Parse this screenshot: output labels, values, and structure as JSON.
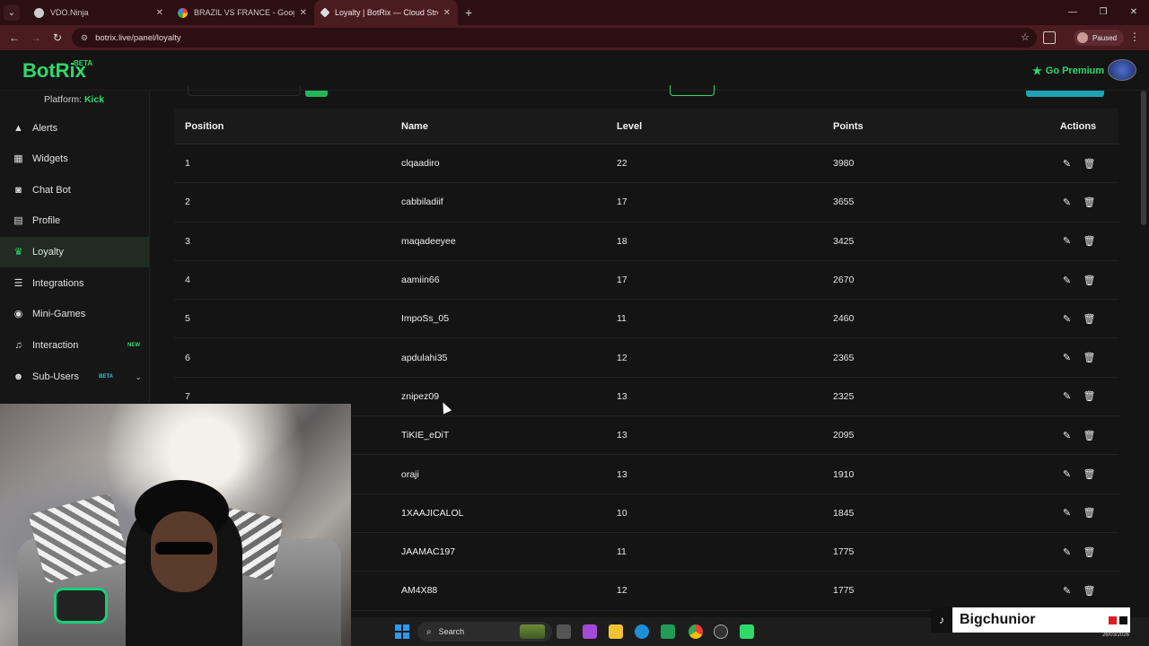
{
  "browser": {
    "tabs": [
      {
        "title": "VDO.Ninja",
        "active": false
      },
      {
        "title": "BRAZIL VS FRANCE - Google Se",
        "active": false
      },
      {
        "title": "Loyalty | BotRix — Cloud Stream",
        "active": true
      }
    ],
    "url": "botrix.live/panel/loyalty",
    "profile_status": "Paused"
  },
  "app": {
    "logo": "BotRix",
    "logo_badge": "BETA",
    "go_premium": "Go Premium",
    "platform_label": "Platform:",
    "platform_value": "Kick"
  },
  "sidebar": {
    "items": [
      {
        "label": "Alerts",
        "icon": "warning-icon"
      },
      {
        "label": "Widgets",
        "icon": "grid-icon"
      },
      {
        "label": "Chat Bot",
        "icon": "robot-icon"
      },
      {
        "label": "Profile",
        "icon": "id-card-icon"
      },
      {
        "label": "Loyalty",
        "icon": "trophy-icon",
        "active": true
      },
      {
        "label": "Integrations",
        "icon": "list-icon"
      },
      {
        "label": "Mini-Games",
        "icon": "gamepad-icon"
      },
      {
        "label": "Interaction",
        "icon": "music-icon",
        "tag": "NEW"
      },
      {
        "label": "Sub-Users",
        "icon": "users-icon",
        "tag": "BETA"
      }
    ]
  },
  "table": {
    "headers": [
      "Position",
      "Name",
      "Level",
      "Points",
      "Actions"
    ],
    "rows": [
      {
        "position": "1",
        "name": "clqaadiro",
        "level": "22",
        "points": "3980"
      },
      {
        "position": "2",
        "name": "cabbiladiif",
        "level": "17",
        "points": "3655"
      },
      {
        "position": "3",
        "name": "maqadeeyee",
        "level": "18",
        "points": "3425"
      },
      {
        "position": "4",
        "name": "aamiin66",
        "level": "17",
        "points": "2670"
      },
      {
        "position": "5",
        "name": "ImpoSs_05",
        "level": "11",
        "points": "2460"
      },
      {
        "position": "6",
        "name": "apdulahi35",
        "level": "12",
        "points": "2365"
      },
      {
        "position": "7",
        "name": "znipez09",
        "level": "13",
        "points": "2325"
      },
      {
        "position": "",
        "name": "TiKIE_eDiT",
        "level": "13",
        "points": "2095"
      },
      {
        "position": "",
        "name": "oraji",
        "level": "13",
        "points": "1910"
      },
      {
        "position": "",
        "name": "1XAAJICALOL",
        "level": "10",
        "points": "1845"
      },
      {
        "position": "",
        "name": "JAAMAC197",
        "level": "11",
        "points": "1775"
      },
      {
        "position": "",
        "name": "AM4X88",
        "level": "12",
        "points": "1775"
      }
    ]
  },
  "taskbar": {
    "search_placeholder": "Search",
    "date": "26/03/2026"
  },
  "overlay": {
    "tiktok_name": "Bigchunior"
  },
  "colors": {
    "accent_green": "#2ed96a",
    "browser_frame": "#4a1b1f"
  }
}
